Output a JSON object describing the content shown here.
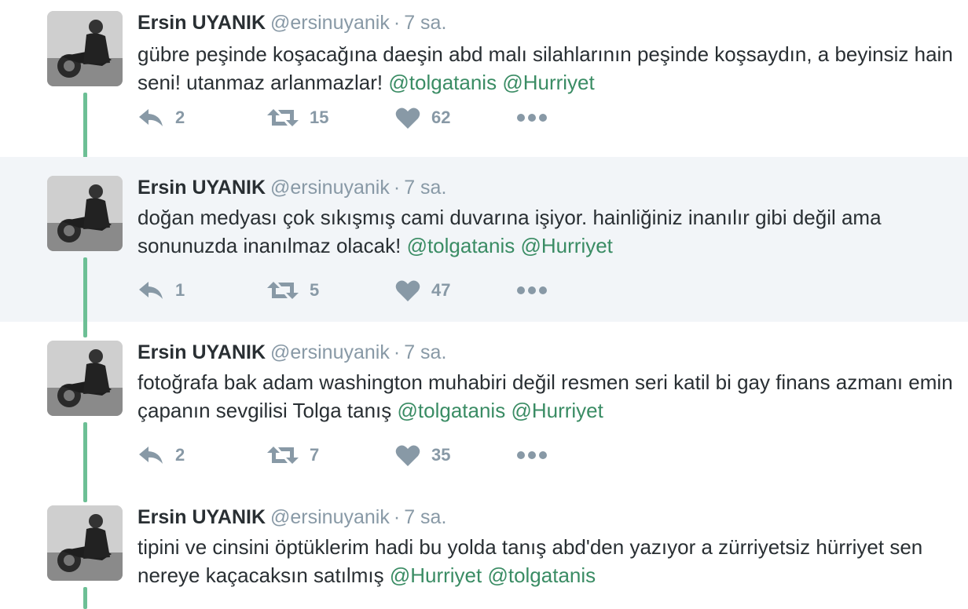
{
  "tweets": [
    {
      "author": "Ersin UYANIK",
      "handle": "@ersinuyanik",
      "separator": "·",
      "time": "7 sa.",
      "text": "gübre peşinde koşacağına daeşin abd malı silahlarının peşinde koşsaydın, a beyinsiz hain seni! utanmaz arlanmazlar!",
      "mentions": [
        "@tolgatanis",
        "@Hurriyet"
      ],
      "replies": "2",
      "retweets": "15",
      "likes": "62",
      "highlighted": false
    },
    {
      "author": "Ersin UYANIK",
      "handle": "@ersinuyanik",
      "separator": "·",
      "time": "7 sa.",
      "text": "doğan medyası çok sıkışmış cami duvarına işiyor. hainliğiniz inanılır gibi değil ama sonunuzda inanılmaz olacak!",
      "mentions": [
        "@tolgatanis",
        "@Hurriyet"
      ],
      "replies": "1",
      "retweets": "5",
      "likes": "47",
      "highlighted": true
    },
    {
      "author": "Ersin UYANIK",
      "handle": "@ersinuyanik",
      "separator": "·",
      "time": "7 sa.",
      "text": "fotoğrafa bak adam washington muhabiri değil resmen seri katil bi gay finans azmanı emin çapanın sevgilisi Tolga tanış",
      "mentions": [
        "@tolgatanis",
        "@Hurriyet"
      ],
      "replies": "2",
      "retweets": "7",
      "likes": "35",
      "highlighted": false
    },
    {
      "author": "Ersin UYANIK",
      "handle": "@ersinuyanik",
      "separator": "·",
      "time": "7 sa.",
      "text": "tipini ve cinsini öptüklerim hadi bu yolda tanış abd'den yazıyor a zürriyetsiz hürriyet sen nereye kaçacaksın satılmış",
      "mentions": [
        "@Hurriyet",
        "@tolgatanis"
      ],
      "replies": "",
      "retweets": "",
      "likes": "",
      "highlighted": false
    }
  ],
  "icons": {
    "reply": "reply-icon",
    "retweet": "retweet-icon",
    "like": "heart-icon",
    "more": "more-dots-icon"
  },
  "colors": {
    "mention": "#3a8c64",
    "thread_line": "#6cbf95",
    "highlight_bg": "#f2f5f8",
    "muted": "#8899a6"
  }
}
